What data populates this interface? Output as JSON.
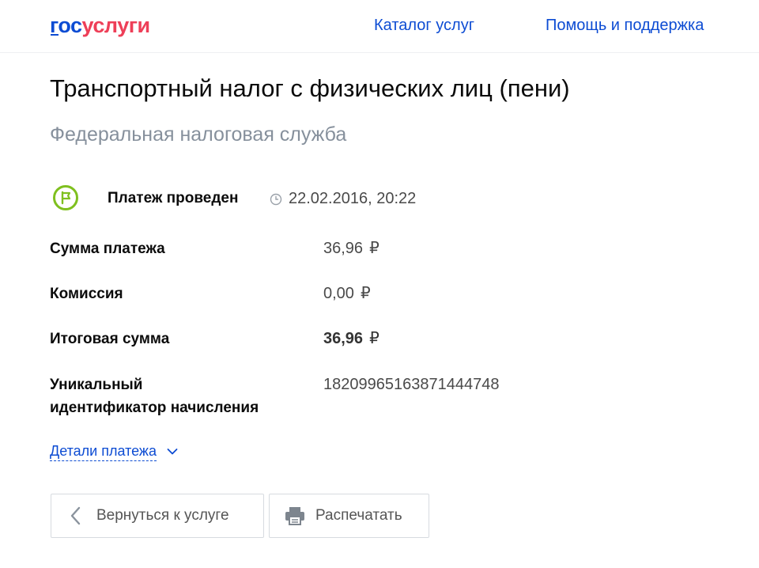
{
  "header": {
    "logo_part1": "гос",
    "logo_part2": "услуги",
    "nav": {
      "catalog": "Каталог услуг",
      "help": "Помощь и поддержка"
    }
  },
  "page": {
    "title": "Транспортный налог с физических лиц (пени)",
    "subtitle": "Федеральная налоговая служба"
  },
  "status": {
    "label": "Платеж проведен",
    "datetime": "22.02.2016, 20:22",
    "icon": "flag-circle-icon",
    "color": "#7fc01f"
  },
  "details": {
    "rows": [
      {
        "label": "Сумма платежа",
        "value": "36,96",
        "currency": "₽"
      },
      {
        "label": "Комиссия",
        "value": "0,00",
        "currency": "₽"
      },
      {
        "label": "Итоговая сумма",
        "value": "36,96",
        "currency": "₽"
      },
      {
        "label_line1": "Уникальный",
        "label_line2": "идентификатор начисления",
        "value": "18209965163871444748"
      }
    ],
    "toggle_label": "Детали платежа"
  },
  "buttons": {
    "back_label": "Вернуться к услуге",
    "print_label": "Распечатать"
  },
  "colors": {
    "brand_blue": "#0d4cd3",
    "brand_red": "#ee3f58",
    "success_green": "#7fc01f"
  }
}
